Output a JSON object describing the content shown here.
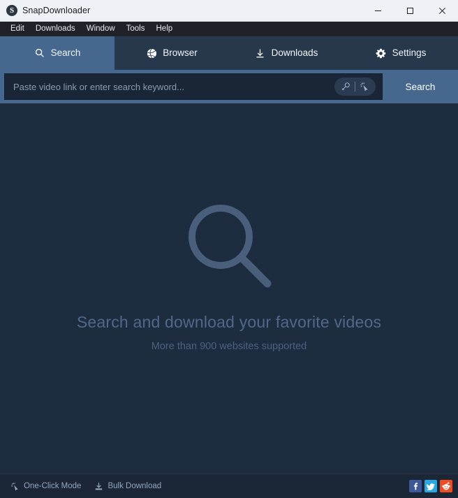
{
  "window": {
    "title": "SnapDownloader",
    "logo_letter": "S",
    "logo_icon": "app-logo-icon",
    "controls": {
      "minimize": "minimize-icon",
      "maximize": "maximize-icon",
      "close": "close-icon"
    },
    "colors": {
      "titlebar_bg": "#eef2f7",
      "menubar_bg": "#1f2329",
      "tabbar_bg": "#27374c",
      "accent_blue": "#46688f",
      "content_bg": "#1e2c3f",
      "input_bg": "#1a2535",
      "statusbar_bg": "#1b2737",
      "hero_text": "#52688a"
    }
  },
  "menubar": {
    "items": [
      {
        "label": "Edit"
      },
      {
        "label": "Downloads"
      },
      {
        "label": "Window"
      },
      {
        "label": "Tools"
      },
      {
        "label": "Help"
      }
    ]
  },
  "tabs": [
    {
      "label": "Search",
      "icon": "search-icon",
      "active": true
    },
    {
      "label": "Browser",
      "icon": "globe-icon",
      "active": false
    },
    {
      "label": "Downloads",
      "icon": "download-icon",
      "active": false
    },
    {
      "label": "Settings",
      "icon": "gear-icon",
      "active": false
    }
  ],
  "search": {
    "value": "",
    "placeholder": "Paste video link or enter search keyword...",
    "inline_tools": [
      {
        "name": "key-icon",
        "title": "Key"
      },
      {
        "name": "magic-cursor-icon",
        "title": "One-Click Mode"
      }
    ],
    "button_label": "Search"
  },
  "main": {
    "hero_icon": "large-magnifier-icon",
    "title": "Search and download your favorite videos",
    "subtitle": "More than 900 websites supported"
  },
  "statusbar": {
    "items": [
      {
        "label": "One-Click Mode",
        "icon": "magic-cursor-icon"
      },
      {
        "label": "Bulk Download",
        "icon": "bulk-download-icon"
      }
    ],
    "socials": [
      {
        "name": "facebook-icon",
        "letter": "f",
        "color": "#3b5998"
      },
      {
        "name": "twitter-icon",
        "letter": "t",
        "color": "#2aa9e0"
      },
      {
        "name": "reddit-icon",
        "letter": "r",
        "color": "#f04b23"
      }
    ]
  }
}
